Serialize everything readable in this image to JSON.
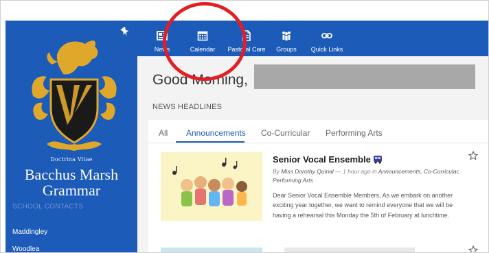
{
  "sidebar": {
    "motto": "Doctrina Vitae",
    "school_name": "Bacchus Marsh Grammar",
    "contacts_heading": "SCHOOL CONTACTS",
    "contacts": [
      "Maddingley",
      "Woodlea"
    ]
  },
  "nav": {
    "items": [
      {
        "label": "News",
        "icon": "newspaper-icon"
      },
      {
        "label": "Calendar",
        "icon": "calendar-icon"
      },
      {
        "label": "Pastoral Care",
        "icon": "pastoral-care-icon"
      },
      {
        "label": "Groups",
        "icon": "groups-icon"
      },
      {
        "label": "Quick Links",
        "icon": "link-icon"
      }
    ]
  },
  "main": {
    "greeting": "Good Morning,",
    "section_heading": "NEWS HEADLINES",
    "tabs": [
      "All",
      "Announcements",
      "Co-Curricular",
      "Performing Arts"
    ],
    "active_tab": "Announcements",
    "post": {
      "title": "Senior Vocal Ensemble",
      "meta_by": "By",
      "author": "Miss Dorothy Quinal",
      "time": "1 hour ago",
      "meta_in": "in",
      "categories": "Announcements, Co-Curricular, Performing Arts",
      "body": "Dear Senior Vocal Ensemble Members, As we embark on another exciting year together, we want to remind everyone that we will be having a rehearsal this Monday the 5th of February at lunchtime."
    }
  },
  "colors": {
    "brand_blue": "#1d5bb8",
    "annotation_red": "#e31e24",
    "crest_gold": "#e0a82b"
  }
}
